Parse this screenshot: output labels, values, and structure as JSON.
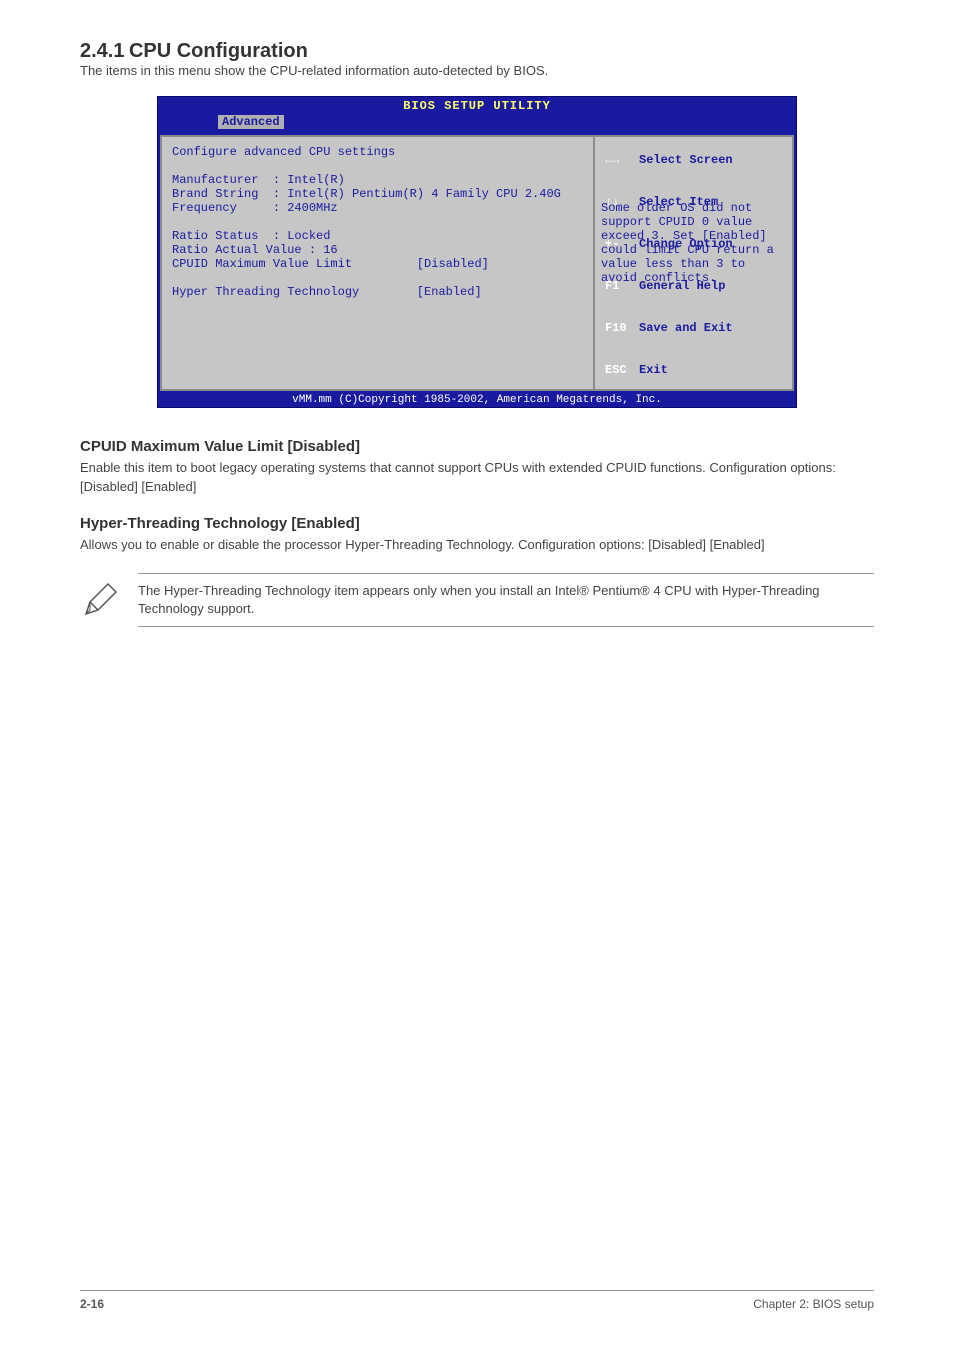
{
  "section": {
    "number": "2.4.1",
    "title": "CPU Configuration",
    "description": "The items in this menu show the CPU-related information auto-detected by BIOS."
  },
  "bios": {
    "title": "BIOS SETUP UTILITY",
    "tab": "Advanced",
    "left_heading": "Configure advanced CPU settings",
    "info": {
      "Manufacturer": "Intel(R)",
      "Brand String": "Intel(R) Pentium(R) 4 Family CPU 2.40G",
      "Frequency": "2400MHz",
      "Ratio Status": "Locked",
      "Ratio Actual Value": "16"
    },
    "options": [
      {
        "label": "CPUID Maximum Value Limit",
        "value": "[Disabled]"
      },
      {
        "label": "Hyper Threading Technology",
        "value": "[Enabled]"
      }
    ],
    "help_text": "Some older OS did not support CPUID 0 value exceed 3. Set [Enabled] could limit CPU return a value less than 3 to avoid conflicts.",
    "nav": [
      {
        "key": "←→",
        "label": "Select Screen"
      },
      {
        "key": "↑↓",
        "label": "Select Item"
      },
      {
        "key": "+-",
        "label": "Change Option"
      },
      {
        "key": "F1",
        "label": "General Help"
      },
      {
        "key": "F10",
        "label": "Save and Exit"
      },
      {
        "key": "ESC",
        "label": "Exit"
      }
    ],
    "footer": "vMM.mm (C)Copyright 1985-2002, American Megatrends, Inc."
  },
  "fields": [
    {
      "title": "CPUID Maximum Value Limit [Disabled]",
      "desc": "Enable this item to boot legacy operating systems that cannot support CPUs with extended CPUID functions. Configuration options: [Disabled] [Enabled]"
    },
    {
      "title": "Hyper-Threading Technology [Enabled]",
      "desc": "Allows you to enable or disable the processor Hyper-Threading Technology. Configuration options: [Disabled] [Enabled]"
    }
  ],
  "note": "The Hyper-Threading Technology item appears only when you install an Intel® Pentium® 4 CPU with Hyper-Threading Technology support.",
  "footer": {
    "left": "2-16",
    "right": "Chapter 2: BIOS setup"
  }
}
